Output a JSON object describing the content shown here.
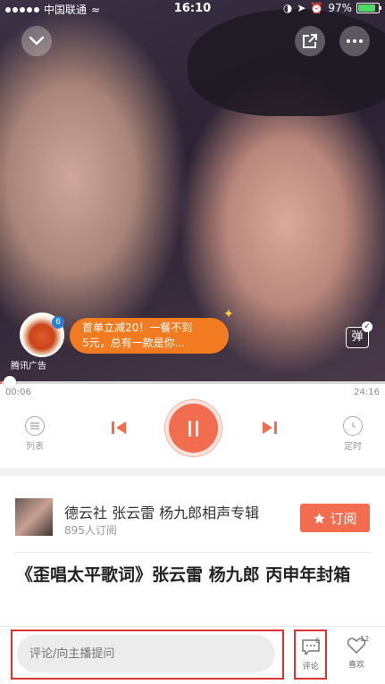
{
  "status_bar": {
    "carrier": "中国联通",
    "time": "16:10",
    "battery_percent": "97%",
    "battery_level": 0.97,
    "battery_color": "#4cd964"
  },
  "top_buttons": {
    "collapse_icon": "chevron-down-icon",
    "share_icon": "share-out-icon",
    "more_icon": "more-dots-icon"
  },
  "ad": {
    "label": "腾讯广告",
    "text_line1": "首单立减20！一餐不到",
    "text_line2": "5元，总有一款是你...",
    "thumb_badge": "6",
    "bubble_color": "#f27b22"
  },
  "danmu": {
    "label": "弹"
  },
  "player": {
    "current_time": "00:06",
    "total_time": "24:16",
    "progress": 0.004,
    "list_label": "列表",
    "timer_label": "定时",
    "accent_color": "#f26c4f"
  },
  "album": {
    "title": "德云社 张云雷 杨九郎相声专辑",
    "subscribers": "895人订阅",
    "subscribe_label": "订阅"
  },
  "track": {
    "title": "《歪唱太平歌词》张云雷 杨九郎 丙申年封箱"
  },
  "bottom_bar": {
    "comment_placeholder": "评论/向主播提问",
    "comment_label": "评论",
    "comment_count": "6",
    "like_label": "喜欢",
    "like_count": "12",
    "highlight_color": "#e03131"
  }
}
